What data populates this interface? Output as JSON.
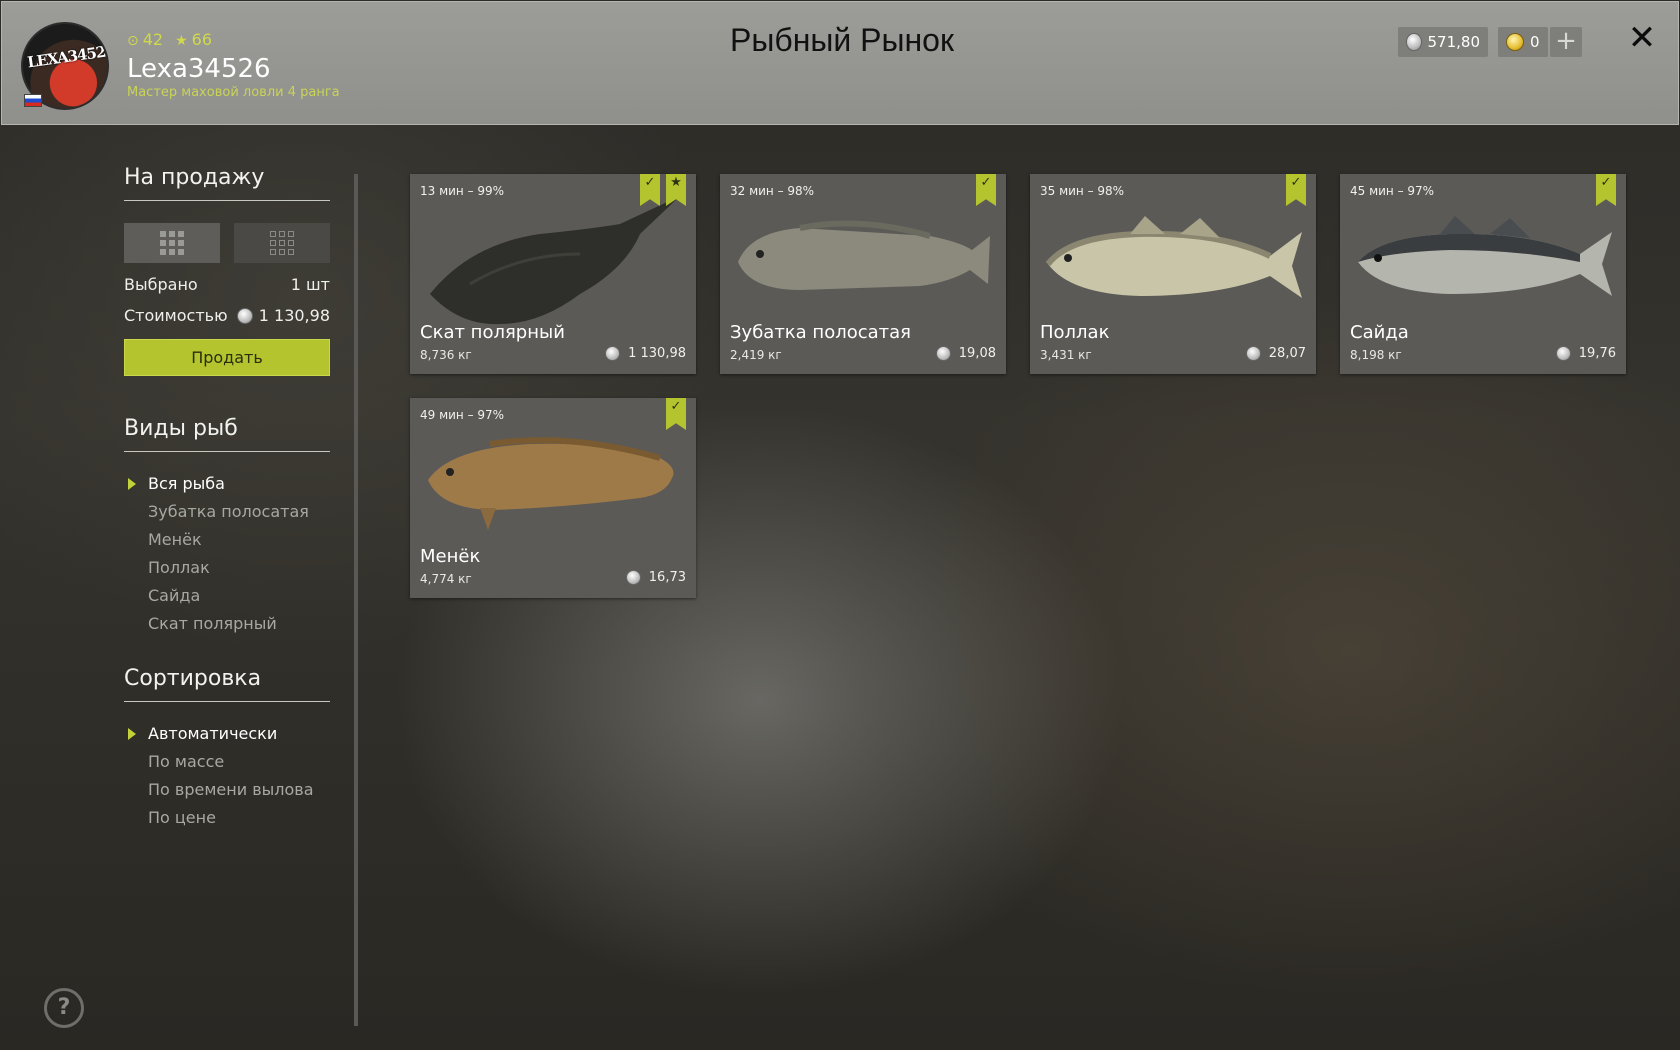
{
  "header": {
    "title": "Рыбный Рынок",
    "avatar_text": "LEXA34526",
    "username": "Lexa34526",
    "rank": "Мастер маховой ловли 4 ранга",
    "level": "42",
    "stars": "66",
    "silver": "571,80",
    "gold": "0",
    "plus_label": "+",
    "close_label": "✕"
  },
  "sidebar": {
    "sale_title": "На продажу",
    "selected_label": "Выбрано",
    "selected_value": "1 шт",
    "cost_label": "Стоимостью",
    "cost_value": "1 130,98",
    "sell_label": "Продать",
    "species_title": "Виды рыб",
    "species": [
      {
        "label": "Вся рыба",
        "active": true
      },
      {
        "label": "Зубатка полосатая",
        "active": false
      },
      {
        "label": "Менёк",
        "active": false
      },
      {
        "label": "Поллак",
        "active": false
      },
      {
        "label": "Сайда",
        "active": false
      },
      {
        "label": "Скат полярный",
        "active": false
      }
    ],
    "sort_title": "Сортировка",
    "sort": [
      {
        "label": "Автоматически",
        "active": true
      },
      {
        "label": "По массе",
        "active": false
      },
      {
        "label": "По времени вылова",
        "active": false
      },
      {
        "label": "По цене",
        "active": false
      }
    ],
    "help_label": "?"
  },
  "cards": [
    {
      "meta": "13 мин – 99%",
      "name": "Скат полярный",
      "weight": "8,736 кг",
      "price": "1 130,98",
      "checked": true,
      "starred": true
    },
    {
      "meta": "32 мин – 98%",
      "name": "Зубатка полосатая",
      "weight": "2,419 кг",
      "price": "19,08",
      "checked": true,
      "starred": false
    },
    {
      "meta": "35 мин – 98%",
      "name": "Поллак",
      "weight": "3,431 кг",
      "price": "28,07",
      "checked": true,
      "starred": false
    },
    {
      "meta": "45 мин – 97%",
      "name": "Сайда",
      "weight": "8,198 кг",
      "price": "19,76",
      "checked": true,
      "starred": false
    },
    {
      "meta": "49 мин – 97%",
      "name": "Менёк",
      "weight": "4,774 кг",
      "price": "16,73",
      "checked": true,
      "starred": false
    }
  ],
  "colors": {
    "accent": "#b4c42e",
    "header_bg": "#9c9c98",
    "card_bg": "#5b5a57"
  },
  "icons": {
    "check": "check-icon",
    "star": "star-icon",
    "coin": "silver-coin-icon",
    "gold": "gold-coin-icon"
  }
}
